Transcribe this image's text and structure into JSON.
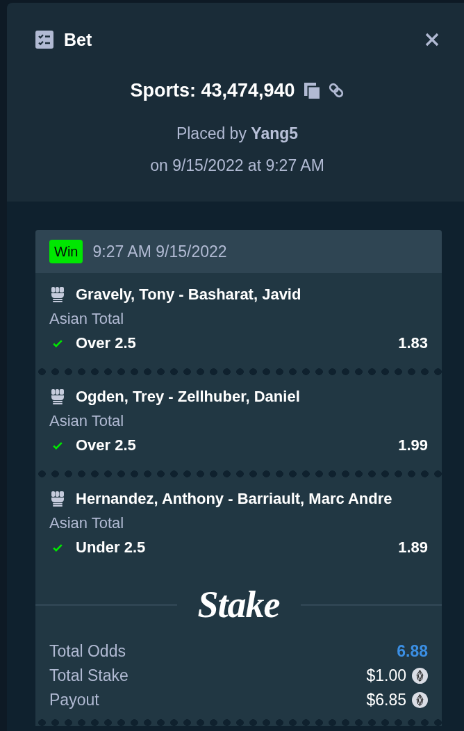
{
  "dialog": {
    "title": "Bet",
    "reference": "Sports: 43,474,940",
    "placed_by": "Placed by **Yang5**",
    "placed_on": "on 9/15/2022 at 9:27 AM"
  },
  "slip": {
    "status": {
      "label": "Win",
      "kind": "win"
    },
    "timestamp": "9:27 AM 9/15/2022",
    "legs": [
      {
        "event": "Gravely, Tony - Basharat, Javid",
        "market": "Asian Total",
        "outcome": "Over 2.5",
        "odds": "1.83",
        "won": true
      },
      {
        "event": "Ogden, Trey - Zellhuber, Daniel",
        "market": "Asian Total",
        "outcome": "Over 2.5",
        "odds": "1.99",
        "won": true
      },
      {
        "event": "Hernandez, Anthony - Barriault, Marc Andre",
        "market": "Asian Total",
        "outcome": "Under 2.5",
        "odds": "1.89",
        "won": true
      }
    ],
    "logo": "Stake",
    "summary": [
      {
        "label": "Total Odds",
        "value": "6.88",
        "kind": "odds"
      },
      {
        "label": "Total Stake",
        "value": "$1.00",
        "kind": "currency"
      },
      {
        "label": "Payout",
        "value": "$6.85",
        "kind": "currency"
      }
    ]
  }
}
